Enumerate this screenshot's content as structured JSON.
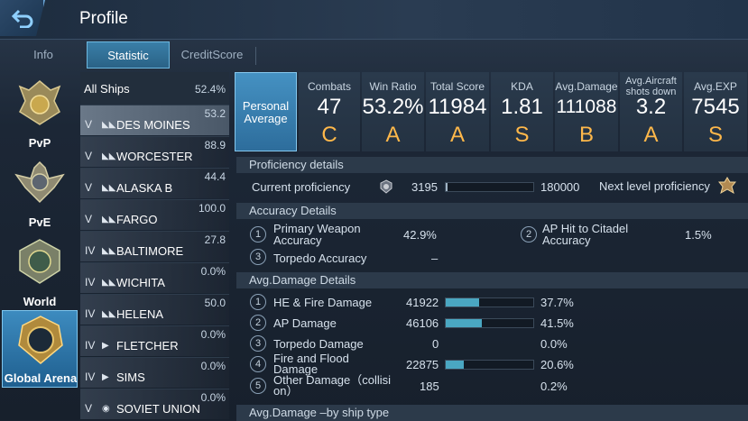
{
  "header": {
    "title": "Profile"
  },
  "tabs": [
    {
      "label": "Info",
      "active": false
    },
    {
      "label": "Statistic",
      "active": true
    },
    {
      "label": "CreditScore",
      "active": false
    }
  ],
  "modes": [
    {
      "label": "PvP",
      "icon": "pvp-emblem-icon"
    },
    {
      "label": "PvE",
      "icon": "pve-emblem-icon"
    },
    {
      "label": "World",
      "icon": "world-emblem-icon"
    },
    {
      "label": "Global Arena",
      "icon": "global-arena-emblem-icon",
      "active": true
    }
  ],
  "ships": {
    "header": {
      "label": "All Ships",
      "value": "52.4%"
    },
    "items": [
      {
        "tier": "V",
        "name": "DES MOINES",
        "value": "53.2"
      },
      {
        "tier": "V",
        "name": "WORCESTER",
        "value": "88.9"
      },
      {
        "tier": "V",
        "name": "ALASKA B",
        "value": "44.4"
      },
      {
        "tier": "V",
        "name": "FARGO",
        "value": "100.0"
      },
      {
        "tier": "IV",
        "name": "BALTIMORE",
        "value": "27.8"
      },
      {
        "tier": "IV",
        "name": "WICHITA",
        "value": "0.0%"
      },
      {
        "tier": "IV",
        "name": "HELENA",
        "value": "50.0"
      },
      {
        "tier": "IV",
        "name": "FLETCHER",
        "value": "0.0%"
      },
      {
        "tier": "IV",
        "name": "SIMS",
        "value": "0.0%"
      },
      {
        "tier": "V",
        "name": "SOVIET UNION",
        "value": "0.0%"
      }
    ]
  },
  "summary": {
    "personal_line1": "Personal",
    "personal_line2": "Average",
    "cards": [
      {
        "label": "Combats",
        "value": "47",
        "grade": "C"
      },
      {
        "label": "Win Ratio",
        "value": "53.2%",
        "grade": "A"
      },
      {
        "label": "Total Score",
        "value": "11984",
        "grade": "A"
      },
      {
        "label": "KDA",
        "value": "1.81",
        "grade": "S"
      },
      {
        "label": "Avg.Damage",
        "value": "111088",
        "grade": "B"
      },
      {
        "label_line1": "Avg.Aircraft",
        "label_line2": "shots down",
        "value": "3.2",
        "grade": "A"
      },
      {
        "label": "Avg.EXP",
        "value": "7545",
        "grade": "S"
      }
    ]
  },
  "proficiency": {
    "title": "Proficiency details",
    "current_label": "Current proficiency",
    "current_value": "3195",
    "max_value": "180000",
    "progress": 0.018,
    "next_label": "Next level proficiency"
  },
  "accuracy": {
    "title": "Accuracy Details",
    "items": [
      {
        "n": "1",
        "label_line1": "Primary Weapon",
        "label_line2": "Accuracy",
        "value": "42.9%"
      },
      {
        "n": "2",
        "label_line1": "AP Hit to Citadel",
        "label_line2": "Accuracy",
        "value": "1.5%"
      },
      {
        "n": "3",
        "label": "Torpedo Accuracy",
        "value": "–"
      }
    ]
  },
  "damage": {
    "title": "Avg.Damage Details",
    "items": [
      {
        "n": "1",
        "label": "HE & Fire Damage",
        "value": "41922",
        "pct": "37.7%",
        "fraction": 0.377
      },
      {
        "n": "2",
        "label": "AP Damage",
        "value": "46106",
        "pct": "41.5%",
        "fraction": 0.415
      },
      {
        "n": "3",
        "label": "Torpedo Damage",
        "value": "0",
        "pct": "0.0%",
        "fraction": 0.0
      },
      {
        "n": "4",
        "label_line1": "Fire and Flood",
        "label_line2": "Damage",
        "value": "22875",
        "pct": "20.6%",
        "fraction": 0.206
      },
      {
        "n": "5",
        "label_line1": "Other Damage（collisi",
        "label_line2": "on）",
        "value": "185",
        "pct": "0.2%",
        "fraction": 0.002
      }
    ]
  },
  "by_ship_type": {
    "title": "Avg.Damage –by ship type"
  }
}
